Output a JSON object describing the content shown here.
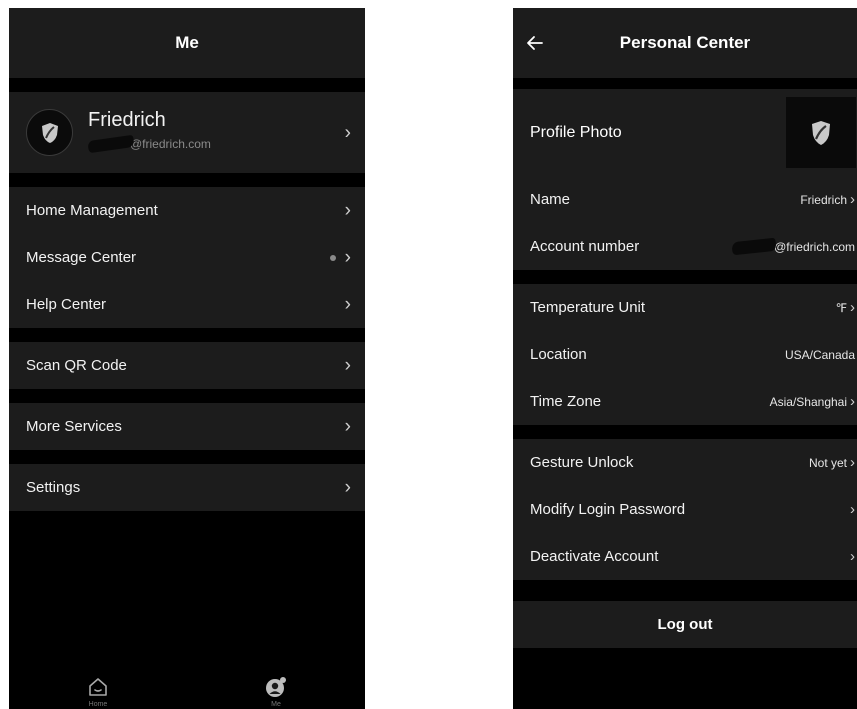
{
  "left": {
    "header": {
      "title": "Me"
    },
    "profile": {
      "name": "Friedrich",
      "email_suffix": "@friedrich.com",
      "avatar_icon": "shield-logo-icon"
    },
    "menu_groups": [
      {
        "items": [
          {
            "label": "Home Management"
          },
          {
            "label": "Message Center"
          },
          {
            "label": "Help Center"
          }
        ]
      },
      {
        "items": [
          {
            "label": "Scan QR Code"
          }
        ]
      },
      {
        "items": [
          {
            "label": "More Services"
          }
        ]
      },
      {
        "items": [
          {
            "label": "Settings"
          }
        ]
      }
    ],
    "tabbar": {
      "home_label": "Home",
      "me_label": "Me"
    }
  },
  "right": {
    "header": {
      "title": "Personal Center",
      "back_icon": "back-arrow-icon"
    },
    "profile_photo_label": "Profile Photo",
    "info": {
      "name_label": "Name",
      "name_value": "Friedrich",
      "account_label": "Account number",
      "account_value_suffix": "@friedrich.com"
    },
    "prefs": {
      "temp_label": "Temperature Unit",
      "temp_value": "℉",
      "location_label": "Location",
      "location_value": "USA/Canada",
      "timezone_label": "Time Zone",
      "timezone_value": "Asia/Shanghai"
    },
    "security": {
      "gesture_label": "Gesture Unlock",
      "gesture_value": "Not yet",
      "password_label": "Modify Login Password",
      "deactivate_label": "Deactivate Account"
    },
    "logout_label": "Log out"
  },
  "colors": {
    "background": "#000000",
    "panel": "#1c1c1c",
    "text": "#f2f2f2",
    "muted": "#8a8a8a"
  }
}
